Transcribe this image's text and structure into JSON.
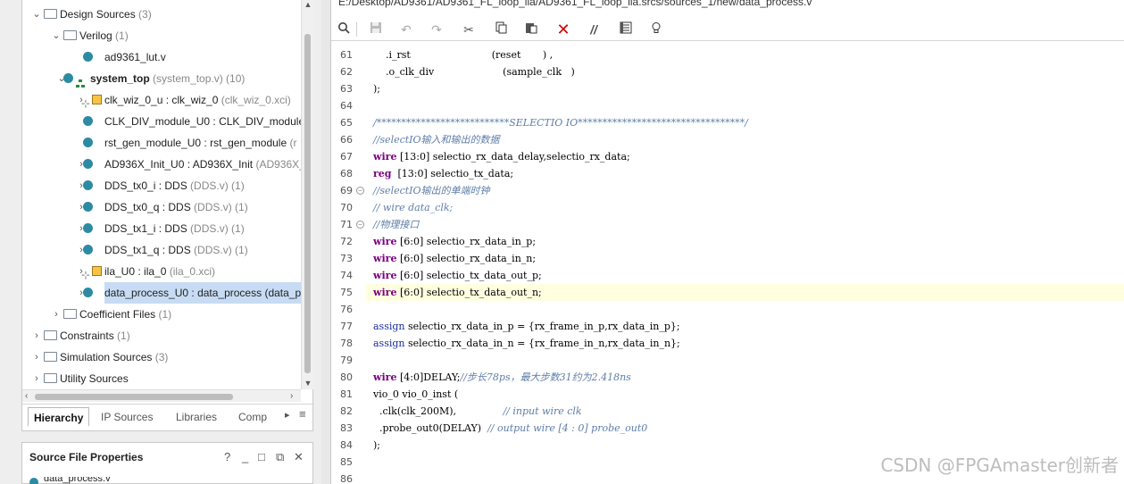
{
  "tree": [
    {
      "label": "Design Sources",
      "dim": " (3)",
      "indent": 42,
      "exp": "⌄",
      "icon": "folder"
    },
    {
      "label": "Verilog",
      "dim": " (1)",
      "indent": 64,
      "exp": "⌄",
      "icon": "folder"
    },
    {
      "label": "ad9361_lut.v",
      "dim": "",
      "indent": 92,
      "exp": "",
      "icon": "dot"
    },
    {
      "label": "system_top",
      "dim": " (system_top.v) (10)",
      "indent": 70,
      "exp": "⌄",
      "icon": "dot-hier",
      "bold": true
    },
    {
      "label": "clk_wiz_0_u : clk_wiz_0",
      "dim": " (clk_wiz_0.xci)",
      "indent": 92,
      "exp": "›",
      "icon": "chip"
    },
    {
      "label": "CLK_DIV_module_U0 : CLK_DIV_module",
      "dim": "",
      "indent": 92,
      "exp": "",
      "icon": "dot"
    },
    {
      "label": "rst_gen_module_U0 : rst_gen_module",
      "dim": " (r",
      "indent": 92,
      "exp": "",
      "icon": "dot"
    },
    {
      "label": "AD936X_Init_U0 : AD936X_Init",
      "dim": " (AD936X_",
      "indent": 92,
      "exp": "›",
      "icon": "dot"
    },
    {
      "label": "DDS_tx0_i : DDS",
      "dim": " (DDS.v) (1)",
      "indent": 92,
      "exp": "›",
      "icon": "dot"
    },
    {
      "label": "DDS_tx0_q : DDS",
      "dim": " (DDS.v) (1)",
      "indent": 92,
      "exp": "›",
      "icon": "dot"
    },
    {
      "label": "DDS_tx1_i : DDS",
      "dim": " (DDS.v) (1)",
      "indent": 92,
      "exp": "›",
      "icon": "dot"
    },
    {
      "label": "DDS_tx1_q : DDS",
      "dim": " (DDS.v) (1)",
      "indent": 92,
      "exp": "›",
      "icon": "dot"
    },
    {
      "label": "ila_U0 : ila_0",
      "dim": " (ila_0.xci)",
      "indent": 92,
      "exp": "›",
      "icon": "chip"
    },
    {
      "label": "data_process_U0 : data_process (data_p",
      "dim": "",
      "indent": 92,
      "exp": "›",
      "icon": "dot",
      "selected": true
    },
    {
      "label": "Coefficient Files",
      "dim": " (1)",
      "indent": 64,
      "exp": "›",
      "icon": "folder"
    },
    {
      "label": "Constraints",
      "dim": " (1)",
      "indent": 42,
      "exp": "›",
      "icon": "folder"
    },
    {
      "label": "Simulation Sources",
      "dim": " (3)",
      "indent": 42,
      "exp": "›",
      "icon": "folder"
    },
    {
      "label": "Utility Sources",
      "dim": "",
      "indent": 42,
      "exp": "›",
      "icon": "folder"
    }
  ],
  "tabs": [
    "Hierarchy",
    "IP Sources",
    "Libraries",
    "Comp"
  ],
  "props": {
    "title": "Source File Properties",
    "file": "data_process.v"
  },
  "editor": {
    "path": "E:/Desktop/AD9361/AD9361_FL_loop_ila/AD9361_FL_loop_ila.srcs/sources_1/new/data_process.v"
  },
  "code": [
    {
      "n": "61",
      "t": "    .i_rst                          (reset       ) ,",
      "c": ""
    },
    {
      "n": "62",
      "t": "    .o_clk_div                      (sample_clk   )",
      "c": ""
    },
    {
      "n": "63",
      "t": ");",
      "c": ""
    },
    {
      "n": "64",
      "t": "",
      "c": ""
    },
    {
      "n": "65",
      "t": "/***************************SELECTIO IO**********************************/",
      "c": "cm"
    },
    {
      "n": "66",
      "t": "//selectIO输入和输出的数据",
      "c": "cm"
    },
    {
      "n": "67",
      "kw": "wire",
      "t": " [13:0] selectio_rx_data_delay,selectio_rx_data;",
      "c": ""
    },
    {
      "n": "68",
      "kw": "reg",
      "t": "  [13:0] selectio_tx_data;",
      "c": ""
    },
    {
      "n": "69",
      "t": "//selectIO输出的单端时钟",
      "c": "cm",
      "fold": true
    },
    {
      "n": "70",
      "t": "// wire data_clk;",
      "c": "cm"
    },
    {
      "n": "71",
      "t": "//物理接口",
      "c": "cm",
      "fold": true
    },
    {
      "n": "72",
      "kw": "wire",
      "t": " [6:0] selectio_rx_data_in_p;",
      "c": ""
    },
    {
      "n": "73",
      "kw": "wire",
      "t": " [6:0] selectio_rx_data_in_n;",
      "c": ""
    },
    {
      "n": "74",
      "kw": "wire",
      "t": " [6:0] selectio_tx_data_out_p;",
      "c": ""
    },
    {
      "n": "75",
      "kw": "wire",
      "t": " [6:0] selectio_tx_data_out_n;",
      "c": "",
      "hl": true
    },
    {
      "n": "76",
      "t": "",
      "c": ""
    },
    {
      "n": "77",
      "kw2": "assign",
      "t": " selectio_rx_data_in_p = {rx_frame_in_p,rx_data_in_p};",
      "c": ""
    },
    {
      "n": "78",
      "kw2": "assign",
      "t": " selectio_rx_data_in_n = {rx_frame_in_n,rx_data_in_n};",
      "c": ""
    },
    {
      "n": "79",
      "t": "",
      "c": ""
    },
    {
      "n": "80",
      "kw": "wire",
      "t": " [4:0]DELAY;",
      "cmt": "//步长78ps，最大步数31约为2.418ns",
      "c": ""
    },
    {
      "n": "81",
      "t": "vio_0 vio_0_inst (",
      "c": ""
    },
    {
      "n": "82",
      "t": "  .clk(clk_200M),               ",
      "cmt": "// input wire clk",
      "c": ""
    },
    {
      "n": "83",
      "t": "  .probe_out0(DELAY)  ",
      "cmt": "// output wire [4 : 0] probe_out0",
      "c": ""
    },
    {
      "n": "84",
      "t": ");",
      "c": ""
    },
    {
      "n": "85",
      "t": "",
      "c": ""
    },
    {
      "n": "86",
      "t": "",
      "c": ""
    }
  ],
  "watermark": "CSDN @FPGAmaster创新者"
}
